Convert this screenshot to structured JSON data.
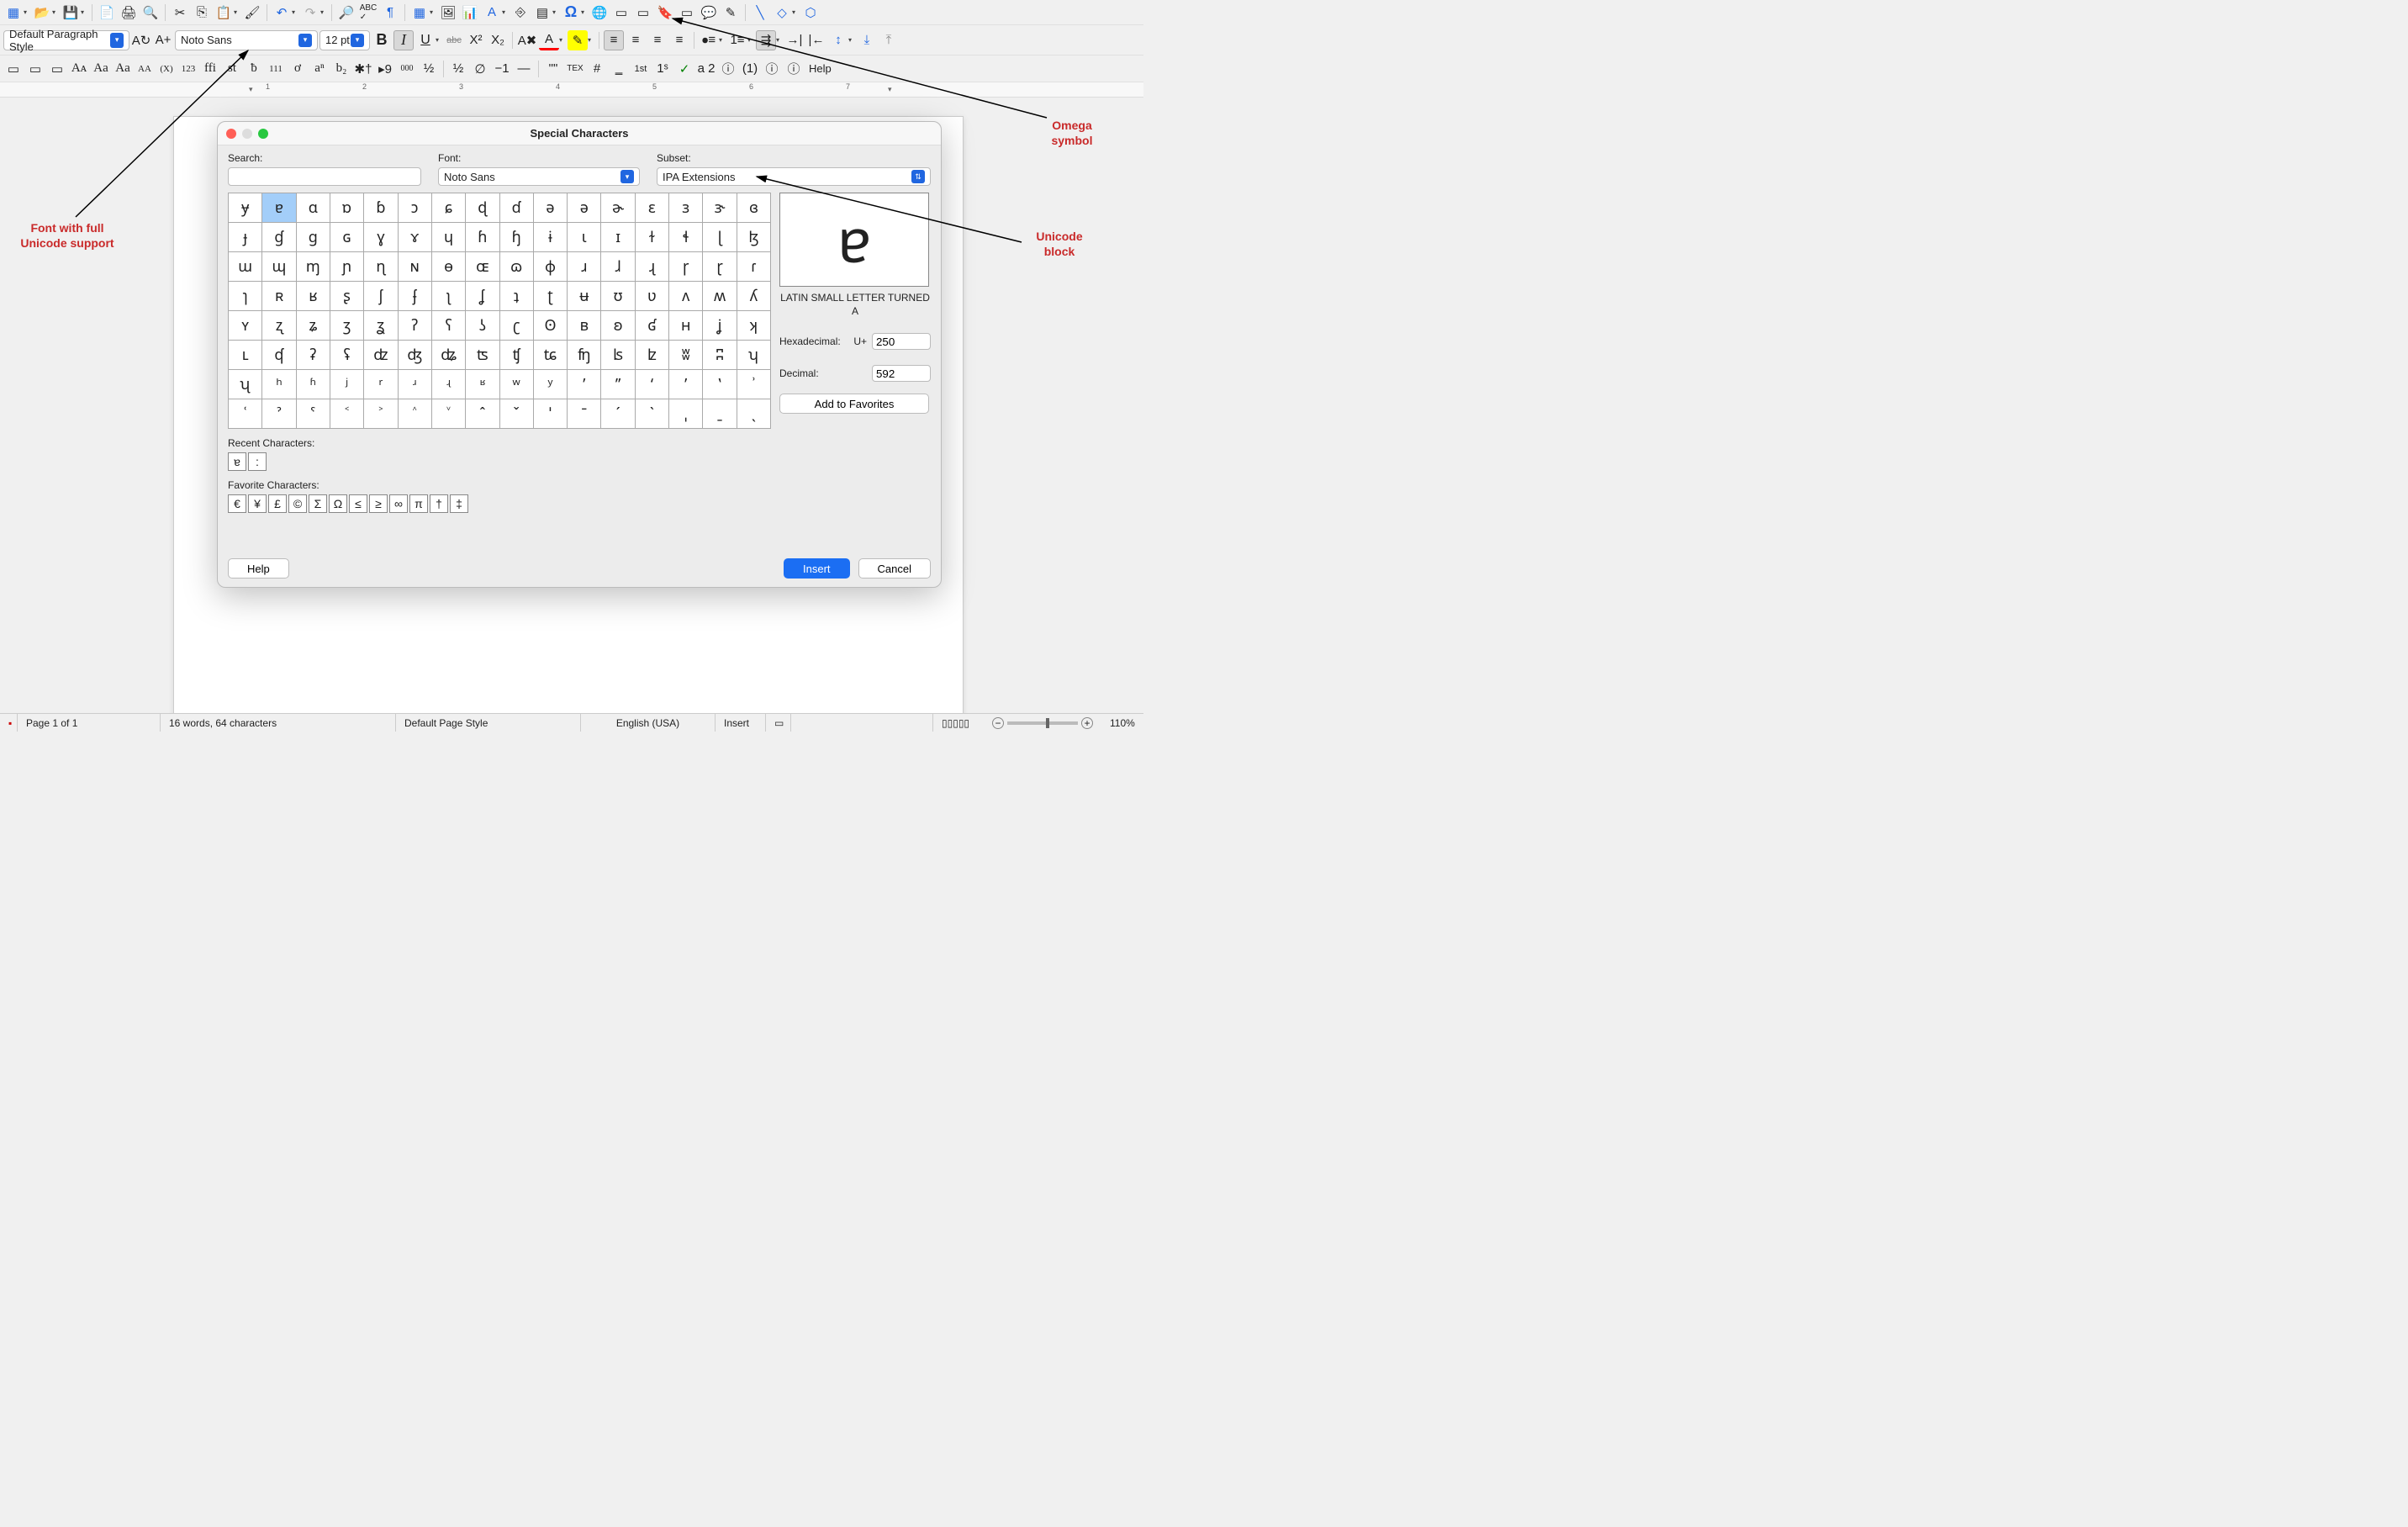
{
  "toolbar": {
    "paragraph_style": "Default Paragraph Style",
    "font_name": "Noto Sans",
    "font_size": "12 pt",
    "help_label": "Help"
  },
  "dialog": {
    "title": "Special Characters",
    "search_label": "Search:",
    "search_value": "",
    "font_label": "Font:",
    "font_value": "Noto Sans",
    "subset_label": "Subset:",
    "subset_value": "IPA Extensions",
    "grid": [
      [
        "ɏ",
        "ɐ",
        "ɑ",
        "ɒ",
        "ɓ",
        "ɔ",
        "ɕ",
        "ɖ",
        "ɗ",
        "ə",
        "ə",
        "ɚ",
        "ɛ",
        "ɜ",
        "ɝ",
        "ɞ"
      ],
      [
        "ɟ",
        "ɠ",
        "ɡ",
        "ɢ",
        "ɣ",
        "ɤ",
        "ɥ",
        "ɦ",
        "ɧ",
        "ɨ",
        "ɩ",
        "ɪ",
        "ɫ",
        "ɬ",
        "ɭ",
        "ɮ"
      ],
      [
        "ɯ",
        "ɰ",
        "ɱ",
        "ɲ",
        "ɳ",
        "ɴ",
        "ɵ",
        "ɶ",
        "ɷ",
        "ɸ",
        "ɹ",
        "ɺ",
        "ɻ",
        "ɼ",
        "ɽ",
        "ɾ"
      ],
      [
        "ɿ",
        "ʀ",
        "ʁ",
        "ʂ",
        "ʃ",
        "ʄ",
        "ʅ",
        "ʆ",
        "ʇ",
        "ʈ",
        "ʉ",
        "ʊ",
        "ʋ",
        "ʌ",
        "ʍ",
        "ʎ"
      ],
      [
        "ʏ",
        "ʐ",
        "ʑ",
        "ʒ",
        "ʓ",
        "ʔ",
        "ʕ",
        "ʖ",
        "ʗ",
        "ʘ",
        "ʙ",
        "ʚ",
        "ʛ",
        "ʜ",
        "ʝ",
        "ʞ"
      ],
      [
        "ʟ",
        "ʠ",
        "ʡ",
        "ʢ",
        "ʣ",
        "ʤ",
        "ʥ",
        "ʦ",
        "ʧ",
        "ʨ",
        "ʩ",
        "ʪ",
        "ʫ",
        "ʬ",
        "ʭ",
        "ʮ"
      ],
      [
        "ʯ",
        "ʰ",
        "ʱ",
        "ʲ",
        "ʳ",
        "ʴ",
        "ʵ",
        "ʶ",
        "ʷ",
        "ʸ",
        "ʹ",
        "ʺ",
        "ʻ",
        "ʼ",
        "ʽ",
        "ʾ"
      ],
      [
        "ʿ",
        "ˀ",
        "ˁ",
        "˂",
        "˃",
        "˄",
        "˅",
        "ˆ",
        "ˇ",
        "ˈ",
        "ˉ",
        "ˊ",
        "ˋ",
        "ˌ",
        "ˍ",
        "ˎ"
      ]
    ],
    "selected_char": "ɐ",
    "char_name": "LATIN SMALL LETTER TURNED A",
    "hex_label": "Hexadecimal:",
    "hex_prefix": "U+",
    "hex_value": "250",
    "dec_label": "Decimal:",
    "dec_value": "592",
    "add_fav_label": "Add to Favorites",
    "recent_label": "Recent Characters:",
    "recent_chars": [
      "ɐ",
      ":"
    ],
    "fav_label": "Favorite Characters:",
    "fav_chars": [
      "€",
      "¥",
      "£",
      "©",
      "Σ",
      "Ω",
      "≤",
      "≥",
      "∞",
      "π",
      "†",
      "‡"
    ],
    "help_btn": "Help",
    "insert_btn": "Insert",
    "cancel_btn": "Cancel"
  },
  "statusbar": {
    "page": "Page 1 of 1",
    "words": "16 words, 64 characters",
    "style": "Default Page Style",
    "lang": "English (USA)",
    "insert": "Insert",
    "zoom": "110%"
  },
  "annotations": {
    "omega": "Omega symbol",
    "font": "Font with full Unicode support",
    "block": "Unicode block"
  }
}
